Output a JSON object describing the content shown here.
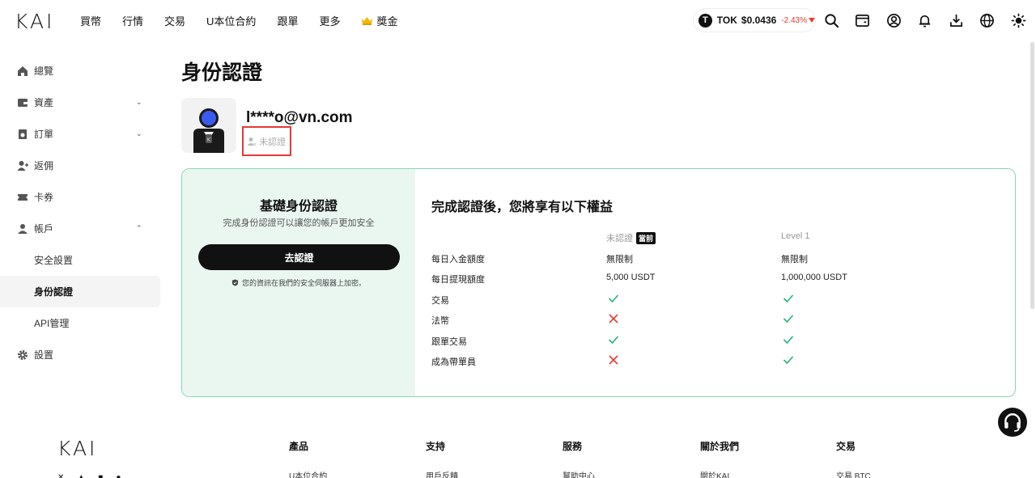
{
  "header": {
    "logo": "KAI",
    "nav": [
      "買幣",
      "行情",
      "交易",
      "U本位合約",
      "跟單",
      "更多"
    ],
    "bonus_label": "獎金",
    "ticker": {
      "icon_letter": "T",
      "symbol": "TOK",
      "price": "$0.0436",
      "change": "-2.43%"
    }
  },
  "sidebar": {
    "items": [
      {
        "label": "總覽",
        "icon": "home-icon"
      },
      {
        "label": "資產",
        "icon": "wallet-icon",
        "chevron": "down"
      },
      {
        "label": "訂單",
        "icon": "order-icon",
        "chevron": "down"
      },
      {
        "label": "返佣",
        "icon": "referral-icon"
      },
      {
        "label": "卡券",
        "icon": "ticket-icon"
      },
      {
        "label": "帳戶",
        "icon": "user-icon",
        "chevron": "up"
      }
    ],
    "sub_items": [
      "安全設置",
      "身份認證",
      "API管理"
    ],
    "settings_label": "設置"
  },
  "main": {
    "title": "身份認證",
    "email": "l****o@vn.com",
    "status": "未認證",
    "basic_card": {
      "title": "基礎身份認證",
      "subtitle": "完成身份認證可以讓您的帳戶更加安全",
      "button": "去認證",
      "secure_note": "您的資訊在我們的安全伺服器上加密。"
    },
    "benefits": {
      "title": "完成認證後，您將享有以下權益",
      "col_current": "未認證",
      "current_badge": "當前",
      "col_level1": "Level 1",
      "rows": [
        {
          "label": "每日入金額度",
          "current": "無限制",
          "level1": "無限制"
        },
        {
          "label": "每日提現額度",
          "current": "5,000 USDT",
          "level1": "1,000,000 USDT"
        },
        {
          "label": "交易",
          "current": "check",
          "level1": "check"
        },
        {
          "label": "法幣",
          "current": "cross",
          "level1": "check"
        },
        {
          "label": "跟單交易",
          "current": "check",
          "level1": "check"
        },
        {
          "label": "成為帶單員",
          "current": "cross",
          "level1": "check"
        }
      ]
    }
  },
  "footer": {
    "logo": "KAI",
    "columns": [
      {
        "title": "產品",
        "first_link": "U本位合約"
      },
      {
        "title": "支持",
        "first_link": "用戶反饋"
      },
      {
        "title": "服務",
        "first_link": "幫助中心"
      },
      {
        "title": "關於我們",
        "first_link": "關於KAI"
      },
      {
        "title": "交易",
        "first_link": "交易 BTC"
      }
    ]
  },
  "colors": {
    "accent_green": "#22b573",
    "danger_red": "#e53935",
    "card_border": "#8ad5b2",
    "card_left_bg": "#eaf7f1"
  }
}
